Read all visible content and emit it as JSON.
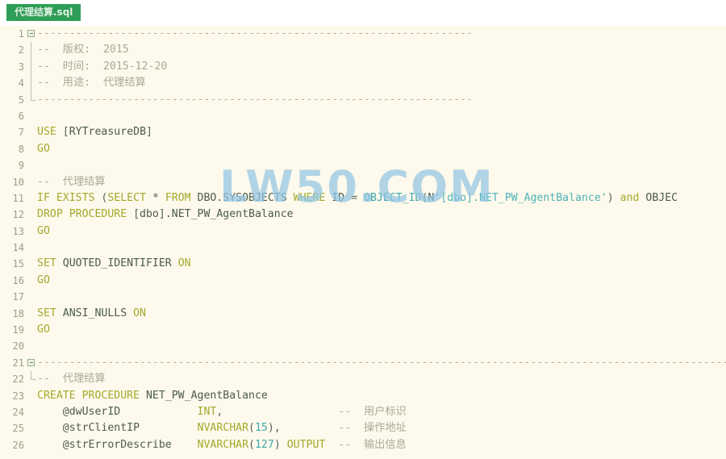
{
  "tab": {
    "label": "代理结算.sql",
    "accent_color": "#2f9e58",
    "text_color": "#dff3e2"
  },
  "editor": {
    "background_color": "#fdf9ec",
    "gutter_color": "#9aa08c",
    "keyword_color": "#a3a92c",
    "comment_color": "#a9ab97",
    "string_color": "#4eb3b8",
    "identifier_color": "#4c5b4f",
    "first_line": 1,
    "last_line": 26
  },
  "watermark": {
    "text": "LW50.COM",
    "color": "#93c6e3"
  },
  "lines": [
    {
      "n": 1,
      "fold": "open",
      "text": "--------------------------------------------------------------------"
    },
    {
      "n": 2,
      "text": "--  版权:  2015"
    },
    {
      "n": 3,
      "text": "--  时间:  2015-12-20"
    },
    {
      "n": 4,
      "text": "--  用途:  代理结算"
    },
    {
      "n": 5,
      "text": "--------------------------------------------------------------------"
    },
    {
      "n": 6,
      "text": ""
    },
    {
      "n": 7,
      "text": "USE [RYTreasureDB]"
    },
    {
      "n": 8,
      "text": "GO"
    },
    {
      "n": 9,
      "text": ""
    },
    {
      "n": 10,
      "text": "--  代理结算"
    },
    {
      "n": 11,
      "text": "IF EXISTS (SELECT * FROM DBO.SYSOBJECTS WHERE ID = OBJECT_ID(N'[dbo].NET_PW_AgentBalance') and OBJEC"
    },
    {
      "n": 12,
      "text": "DROP PROCEDURE [dbo].NET_PW_AgentBalance"
    },
    {
      "n": 13,
      "text": "GO"
    },
    {
      "n": 14,
      "text": ""
    },
    {
      "n": 15,
      "text": "SET QUOTED_IDENTIFIER ON"
    },
    {
      "n": 16,
      "text": "GO"
    },
    {
      "n": 17,
      "text": ""
    },
    {
      "n": 18,
      "text": "SET ANSI_NULLS ON"
    },
    {
      "n": 19,
      "text": "GO"
    },
    {
      "n": 20,
      "text": ""
    },
    {
      "n": 21,
      "fold": "open",
      "text": "-------------------------------------------------------------------------------------------------------------------------"
    },
    {
      "n": 22,
      "text": "--  代理结算"
    },
    {
      "n": 23,
      "text": "CREATE PROCEDURE NET_PW_AgentBalance"
    },
    {
      "n": 24,
      "text": "    @dwUserID            INT,                   --  用户标识"
    },
    {
      "n": 25,
      "text": "    @strClientIP         NVARCHAR(15),          --  操作地址"
    },
    {
      "n": 26,
      "text": "    @strErrorDescribe    NVARCHAR(127) OUTPUT   --  输出信息"
    }
  ]
}
